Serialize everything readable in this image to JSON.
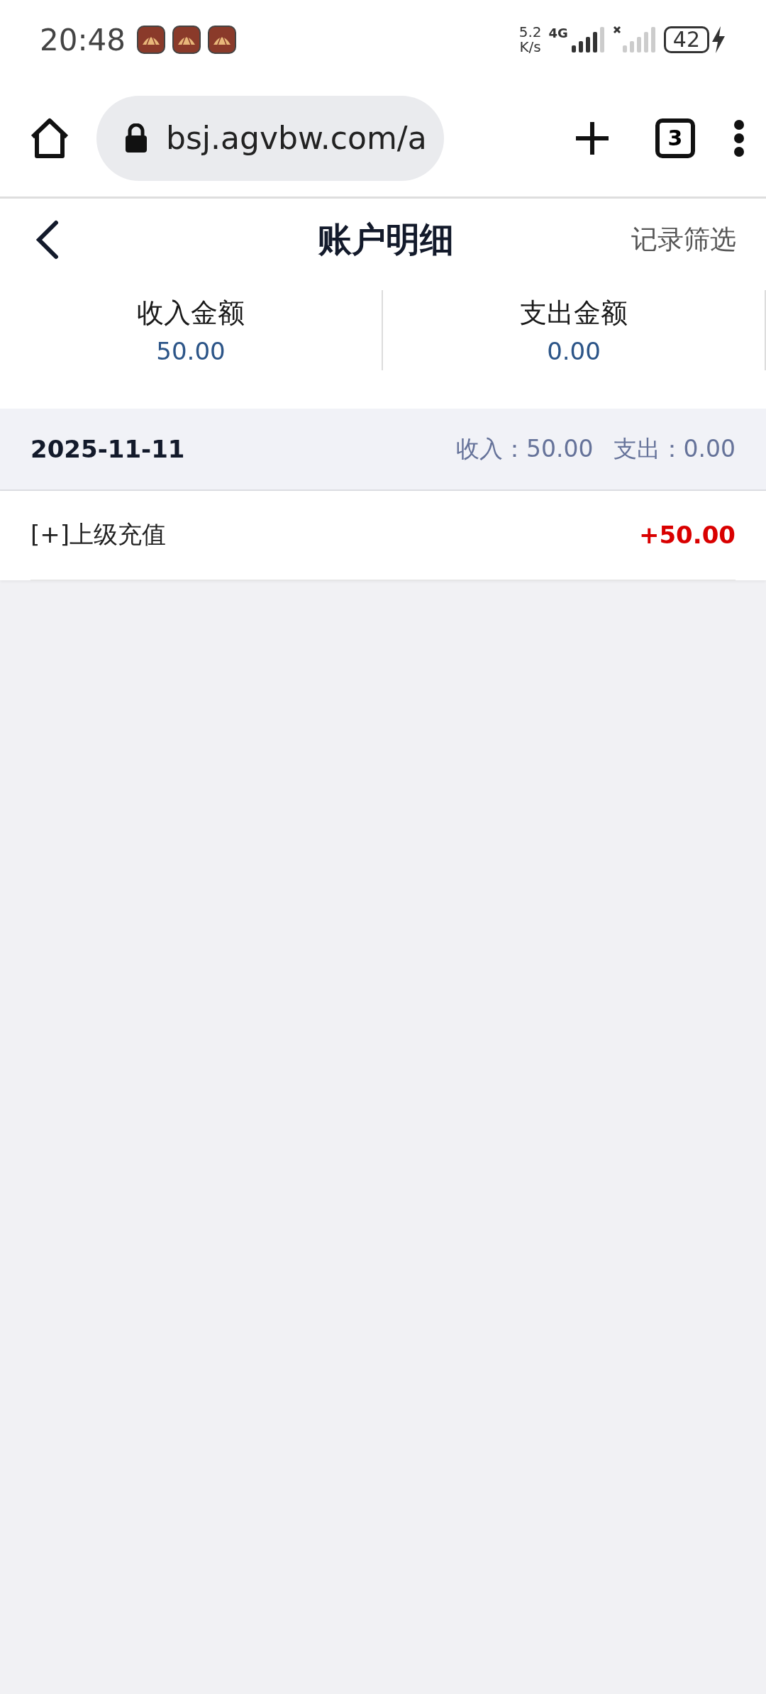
{
  "status_bar": {
    "time": "20:48",
    "notifications": [
      {
        "kind": "app"
      },
      {
        "kind": "app"
      },
      {
        "kind": "app"
      }
    ],
    "speed_value": "5.2",
    "speed_unit": "K/s",
    "network": "4G",
    "battery": "42"
  },
  "browser": {
    "url": "bsj.agvbw.com/a",
    "tab_count": "3"
  },
  "header": {
    "title": "账户明细",
    "action": "记录筛选"
  },
  "summary": [
    {
      "label": "收入金额",
      "value": "50.00"
    },
    {
      "label": "支出金额",
      "value": "0.00"
    }
  ],
  "days": [
    {
      "date": "2025-11-11",
      "income": "收入：50.00",
      "expense": "支出：0.00",
      "entries": [
        {
          "title": "[+]上级充值",
          "amount": "+50.00",
          "kind": "income"
        }
      ]
    }
  ]
}
